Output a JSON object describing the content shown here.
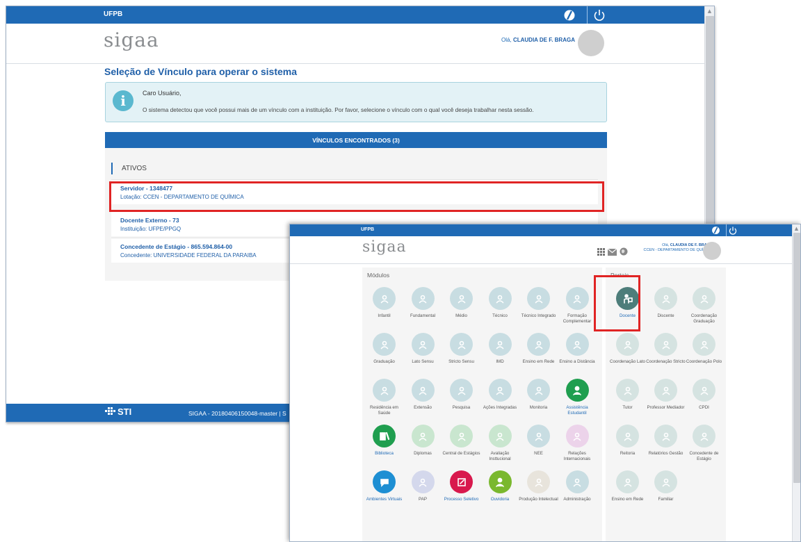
{
  "back": {
    "institution": "UFPB",
    "logo": "sigaa",
    "greeting_prefix": "Olá,",
    "greeting_user": "CLAUDIA DE F. BRAGA",
    "page_title": "Seleção de Vínculo para operar o sistema",
    "info_title": "Caro Usuário,",
    "info_text": "O sistema detectou que você possui mais de um vínculo com a instituição. Por favor, selecione o vínculo com o qual você deseja trabalhar nesta sessão.",
    "panel_title": "VÍNCULOS ENCONTRADOS (3)",
    "active_label": "ATIVOS",
    "vinculos": [
      {
        "title": "Servidor - 1348477",
        "sub": "Lotação: CCEN - DEPARTAMENTO DE QUÍMICA"
      },
      {
        "title": "Docente Externo - 73",
        "sub": "Instituição: UFPE/PPGQ"
      },
      {
        "title": "Concedente de Estágio - 865.594.864-00",
        "sub": "Concedente: UNIVERSIDADE FEDERAL DA PARAIBA"
      }
    ],
    "footer_logo": "STI",
    "footer_text": "SIGAA - 20180406150048-master | S"
  },
  "front": {
    "institution": "UFPB",
    "logo": "sigaa",
    "greeting_prefix": "Olá,",
    "greeting_user": "CLAUDIA DE F. BRAGA",
    "greeting_unit": "CCEN - DEPARTAMENTO DE QUÍMICA",
    "modules_label": "Módulos",
    "portals_label": "Portais",
    "modules": [
      {
        "label": "Infantil",
        "icon": "infantil-icon",
        "color": "#c8dde2",
        "active": false
      },
      {
        "label": "Fundamental",
        "icon": "fundamental-icon",
        "color": "#c8dde2",
        "active": false
      },
      {
        "label": "Médio",
        "icon": "medio-icon",
        "color": "#c8dde2",
        "active": false
      },
      {
        "label": "Técnico",
        "icon": "tecnico-icon",
        "color": "#c8dde2",
        "active": false
      },
      {
        "label": "Técnico Integrado",
        "icon": "tecnico-integrado-icon",
        "color": "#c8dde2",
        "active": false
      },
      {
        "label": "Formação Complementar",
        "icon": "formacao-complementar-icon",
        "color": "#c8dde2",
        "active": false
      },
      {
        "label": "Graduação",
        "icon": "graduacao-icon",
        "color": "#c8dde2",
        "active": false
      },
      {
        "label": "Lato Sensu",
        "icon": "lato-sensu-icon",
        "color": "#c8dde2",
        "active": false
      },
      {
        "label": "Stricto Sensu",
        "icon": "stricto-sensu-icon",
        "color": "#c8dde2",
        "active": false
      },
      {
        "label": "IMD",
        "icon": "imd-icon",
        "color": "#c8dde2",
        "active": false
      },
      {
        "label": "Ensino em Rede",
        "icon": "ensino-rede-icon",
        "color": "#c8dde2",
        "active": false
      },
      {
        "label": "Ensino a Distância",
        "icon": "ead-icon",
        "color": "#c8dde2",
        "active": false
      },
      {
        "label": "Residência em Saúde",
        "icon": "residencia-icon",
        "color": "#c8dde2",
        "active": false
      },
      {
        "label": "Extensão",
        "icon": "extensao-icon",
        "color": "#c8dde2",
        "active": false
      },
      {
        "label": "Pesquisa",
        "icon": "pesquisa-icon",
        "color": "#c8dde2",
        "active": false
      },
      {
        "label": "Ações Integradas",
        "icon": "acoes-integradas-icon",
        "color": "#c8dde2",
        "active": false
      },
      {
        "label": "Monitoria",
        "icon": "monitoria-icon",
        "color": "#c8dde2",
        "active": false
      },
      {
        "label": "Assistência Estudantil",
        "icon": "assistencia-icon",
        "color": "#1f9e4f",
        "active": true
      },
      {
        "label": "Biblioteca",
        "icon": "biblioteca-icon",
        "color": "#1f9e4f",
        "active": true
      },
      {
        "label": "Diplomas",
        "icon": "diplomas-icon",
        "color": "#c9e6cf",
        "active": false
      },
      {
        "label": "Central de Estágios",
        "icon": "central-estagios-icon",
        "color": "#c9e6cf",
        "active": false
      },
      {
        "label": "Avaliação Insttucional",
        "icon": "avaliacao-icon",
        "color": "#c9e6cf",
        "active": false
      },
      {
        "label": "NEE",
        "icon": "nee-icon",
        "color": "#c8dde2",
        "active": false
      },
      {
        "label": "Relações Internacionais",
        "icon": "relacoes-icon",
        "color": "#ecd3ea",
        "active": false
      },
      {
        "label": "Ambientes Virtuais",
        "icon": "ambientes-virtuais-icon",
        "color": "#1e8fd3",
        "active": true
      },
      {
        "label": "PAP",
        "icon": "pap-icon",
        "color": "#d4d8ec",
        "active": false
      },
      {
        "label": "Processo Seletivo",
        "icon": "processo-seletivo-icon",
        "color": "#d8194d",
        "active": true
      },
      {
        "label": "Ouvidoria",
        "icon": "ouvidoria-icon",
        "color": "#7ab82e",
        "active": true
      },
      {
        "label": "Produção Intelectual",
        "icon": "producao-icon",
        "color": "#e8e4dc",
        "active": false
      },
      {
        "label": "Administração",
        "icon": "administracao-icon",
        "color": "#c8dde2",
        "active": false
      }
    ],
    "portals": [
      {
        "label": "Docente",
        "icon": "docente-icon",
        "color": "#4d7d7a",
        "active": true
      },
      {
        "label": "Discente",
        "icon": "discente-icon",
        "color": "#d5e3e1",
        "active": false
      },
      {
        "label": "Coordenação Graduação",
        "icon": "coord-graduacao-icon",
        "color": "#d5e3e1",
        "active": false
      },
      {
        "label": "Coordenação Lato",
        "icon": "coord-lato-icon",
        "color": "#d5e3e1",
        "active": false
      },
      {
        "label": "Coordenação Stricto",
        "icon": "coord-stricto-icon",
        "color": "#d5e3e1",
        "active": false
      },
      {
        "label": "Coordenação Polo",
        "icon": "coord-polo-icon",
        "color": "#d5e3e1",
        "active": false
      },
      {
        "label": "Tutor",
        "icon": "tutor-icon",
        "color": "#d5e3e1",
        "active": false
      },
      {
        "label": "Professor Mediador",
        "icon": "professor-mediador-icon",
        "color": "#d5e3e1",
        "active": false
      },
      {
        "label": "CPDI",
        "icon": "cpdi-icon",
        "color": "#d5e3e1",
        "active": false
      },
      {
        "label": "Reitoria",
        "icon": "reitoria-icon",
        "color": "#d5e3e1",
        "active": false
      },
      {
        "label": "Relatórios Gestão",
        "icon": "relatorios-icon",
        "color": "#d5e3e1",
        "active": false
      },
      {
        "label": "Concedente de Estágio",
        "icon": "concedente-icon",
        "color": "#d5e3e1",
        "active": false
      },
      {
        "label": "Ensino em Rede",
        "icon": "portal-ensino-rede-icon",
        "color": "#d5e3e1",
        "active": false
      },
      {
        "label": "Familiar",
        "icon": "familiar-icon",
        "color": "#d5e3e1",
        "active": false
      }
    ]
  }
}
